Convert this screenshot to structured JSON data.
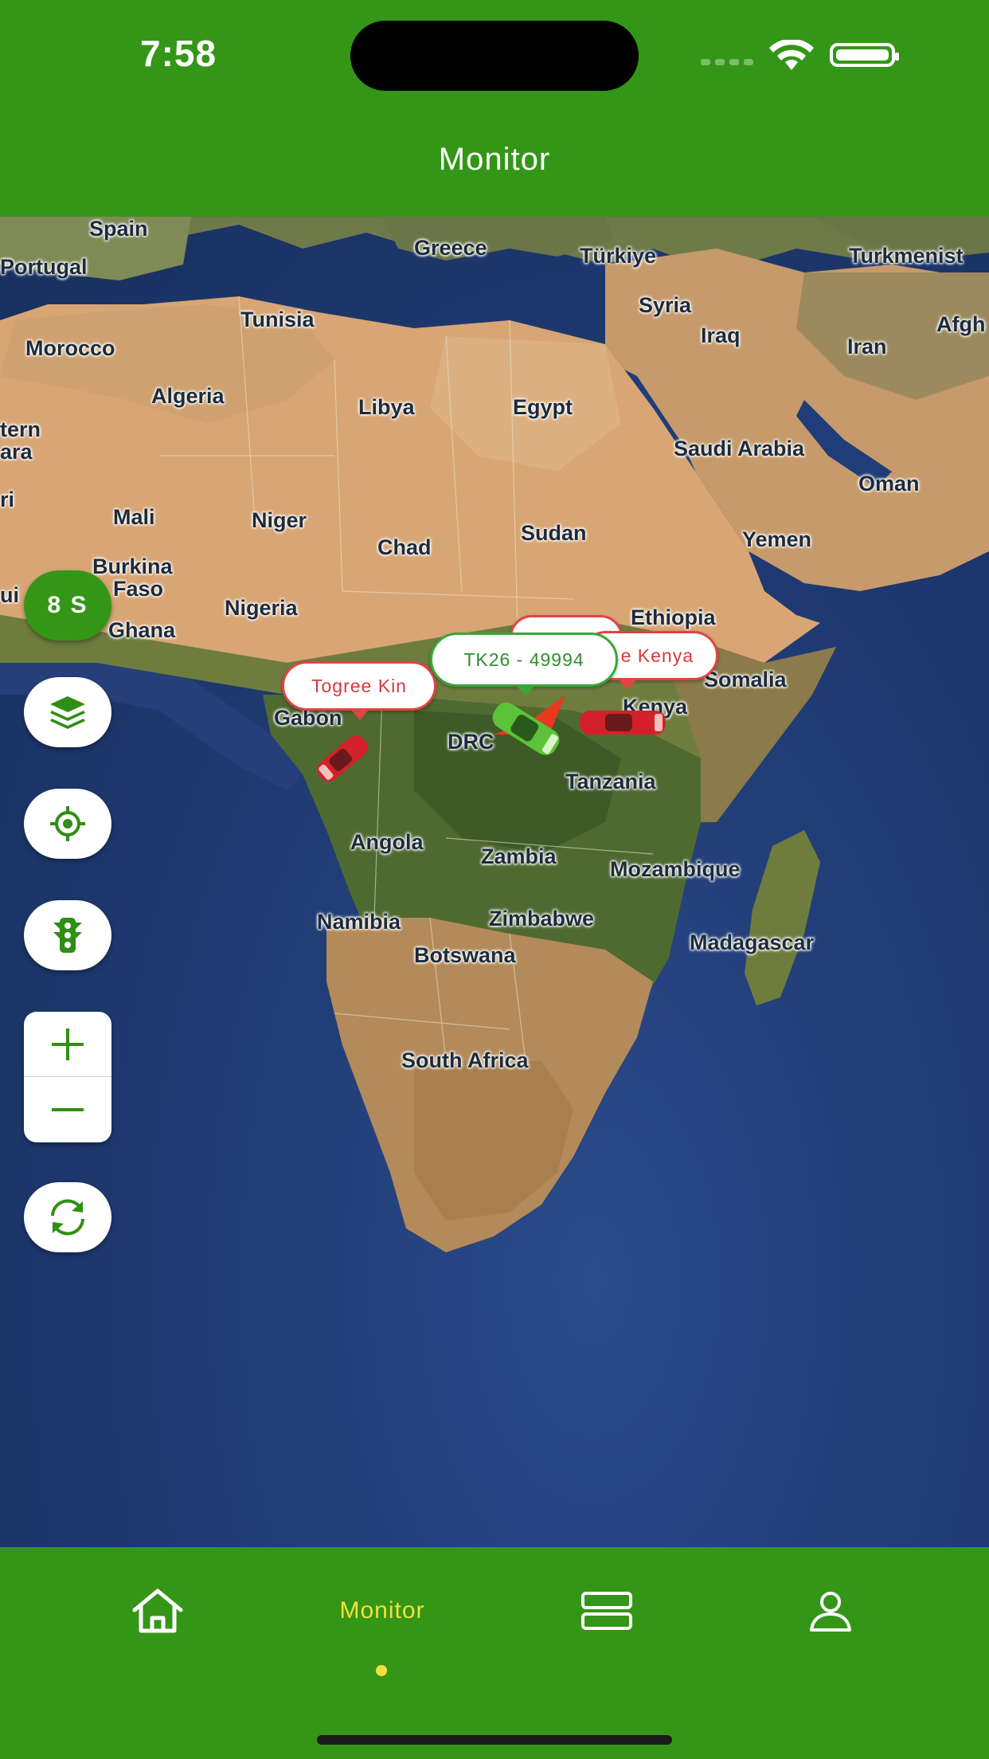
{
  "status_bar": {
    "time": "7:58"
  },
  "header": {
    "title": "Monitor"
  },
  "map": {
    "countries": [
      "Spain",
      "Portugal",
      "Greece",
      "Türkiye",
      "Turkmenist",
      "Tunisia",
      "Syria",
      "Iraq",
      "Iran",
      "Afgh",
      "Morocco",
      "Algeria",
      "Libya",
      "Egypt",
      "Saudi Arabia",
      "Oman",
      "tern",
      "ara",
      "Mali",
      "Niger",
      "Chad",
      "Sudan",
      "Yemen",
      "Burkina",
      "Faso",
      "Ghana",
      "Nigeria",
      "Ethiopia",
      "Somalia",
      "Gabon",
      "DRC",
      "Kenya",
      "Tanzania",
      "Angola",
      "Zambia",
      "Mozambique",
      "Namibia",
      "Zimbabwe",
      "Botswana",
      "Madagascar",
      "South Africa",
      "ri",
      "ui"
    ],
    "controls": {
      "refresh_interval": "8 S",
      "layers_icon": "layers-icon",
      "locate_icon": "crosshair-icon",
      "traffic_icon": "traffic-light-icon",
      "zoom_in_icon": "plus-icon",
      "zoom_out_icon": "minus-icon",
      "refresh_icon": "refresh-icon"
    },
    "vehicles": [
      {
        "label": "Togree Kin",
        "status": "offline",
        "color": "#e24444"
      },
      {
        "label": "e Kenya",
        "status": "offline",
        "color": "#e24444"
      },
      {
        "label": "TK26 - 49994",
        "status": "online",
        "color": "#3aa63a"
      }
    ]
  },
  "bottom_nav": {
    "items": [
      {
        "icon": "home-icon",
        "label": ""
      },
      {
        "icon": "",
        "label": "Monitor",
        "active": true
      },
      {
        "icon": "list-icon",
        "label": ""
      },
      {
        "icon": "user-icon",
        "label": ""
      }
    ]
  },
  "colors": {
    "primary": "#349617",
    "active": "#f4e03a",
    "offline": "#e24444",
    "online": "#3aa63a"
  }
}
